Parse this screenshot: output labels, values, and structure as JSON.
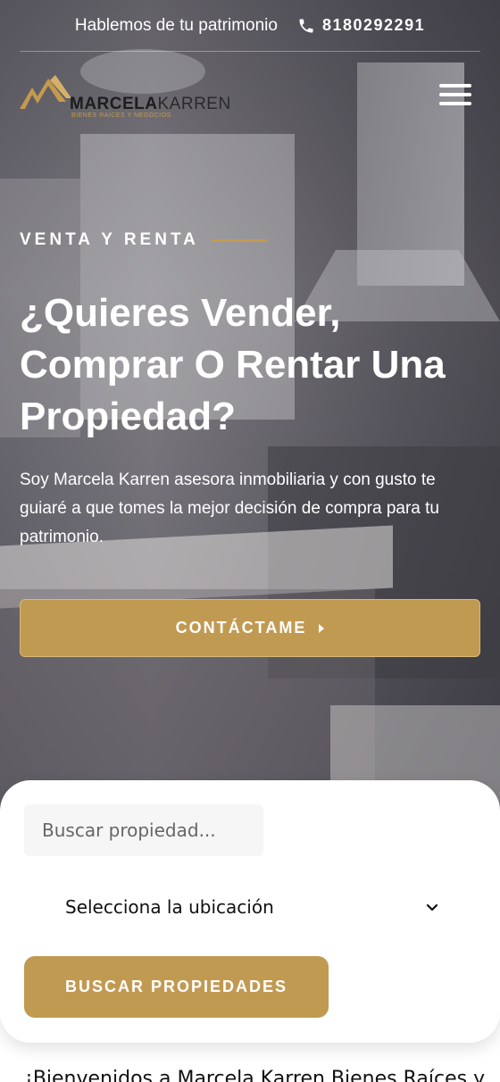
{
  "topbar": {
    "tagline": "Hablemos de tu patrimonio",
    "phone": "8180292291",
    "phone_icon": "phone-icon"
  },
  "brand": {
    "name_bold": "MARCELA",
    "name_light": "KARREN",
    "subtitle": "BIENES RAÍCES Y NEGOCIOS",
    "logo_icon": "roof-logo-icon",
    "accent_color": "#c19a52"
  },
  "nav": {
    "menu_icon": "hamburger-menu-icon"
  },
  "hero": {
    "eyebrow": "VENTA Y RENTA",
    "headline": "¿Quieres Vender, Comprar O Rentar Una Propiedad?",
    "description": "Soy Marcela Karren asesora inmobiliaria y con gusto te guiaré a que tomes la mejor decisión de compra para tu patrimonio.",
    "cta_label": "CONTÁCTAME"
  },
  "search": {
    "placeholder": "Buscar propiedad...",
    "location_label": "Selecciona la ubicación",
    "button_label": "BUSCAR PROPIEDADES"
  },
  "welcome": {
    "text": "¡Bienvenidos a Marcela Karren Bienes Raíces y"
  }
}
